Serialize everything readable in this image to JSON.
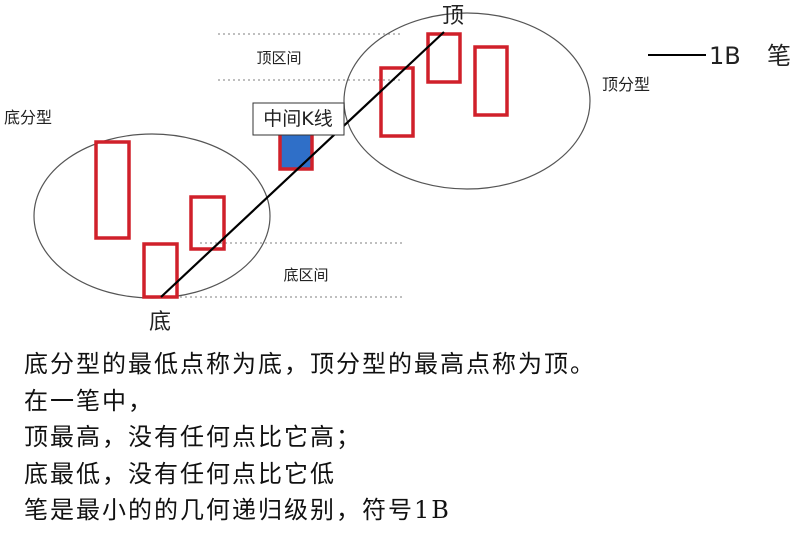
{
  "labels": {
    "top_interval": "顶区间",
    "bottom_interval": "底区间",
    "middle_k": "中间K线",
    "top_point": "顶",
    "bottom_point": "底",
    "bottom_fractal": "底分型",
    "top_fractal": "顶分型",
    "legend_symbol": "1B",
    "legend_name": "笔"
  },
  "colors": {
    "candle_outline": "#d0202a",
    "middle_fill": "#2f6fc8",
    "stroke_line": "#000000",
    "ellipse": "#555555",
    "dotted": "#999999"
  },
  "body_text": [
    "底分型的最低点称为底，顶分型的最高点称为顶。",
    "在一笔中，",
    "顶最高，没有任何点比它高；",
    "底最低，没有任何点比它低",
    "笔是最小的的几何递归级别，符号1B"
  ]
}
